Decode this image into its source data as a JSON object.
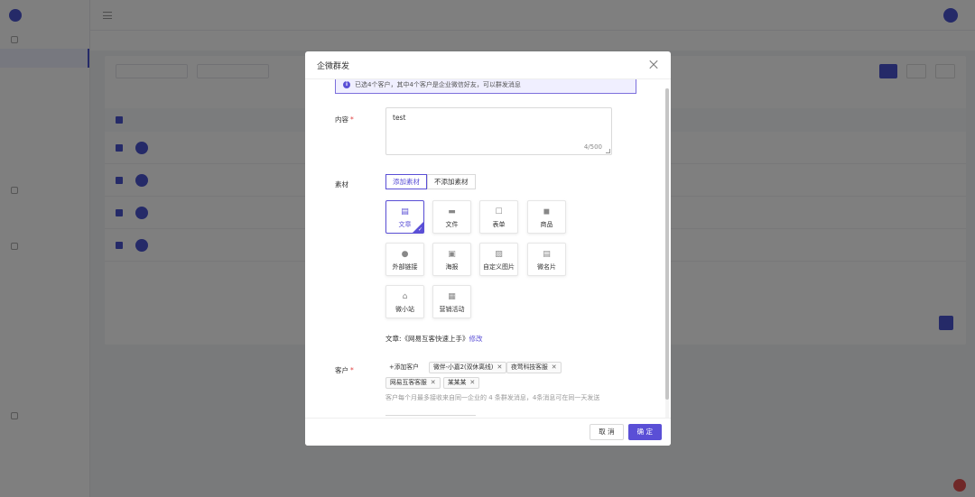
{
  "modal": {
    "title": "企微群发",
    "info_text": "已选4个客户，其中4个客户是企业微信好友，可以群发消息",
    "content_label": "内容",
    "content_value": "test",
    "content_count": "4/500",
    "material_label": "素材",
    "seg_add": "添加素材",
    "seg_none": "不添加素材",
    "materials": [
      {
        "label": "文章",
        "icon": "article-icon",
        "selected": true
      },
      {
        "label": "文件",
        "icon": "folder-icon"
      },
      {
        "label": "表单",
        "icon": "form-icon"
      },
      {
        "label": "商品",
        "icon": "product-icon"
      },
      {
        "label": "外部链接",
        "icon": "link-icon"
      },
      {
        "label": "海报",
        "icon": "poster-icon"
      },
      {
        "label": "自定义图片",
        "icon": "image-icon"
      },
      {
        "label": "微名片",
        "icon": "card-icon"
      },
      {
        "label": "微小站",
        "icon": "home-icon"
      },
      {
        "label": "营销活动",
        "icon": "gift-icon"
      }
    ],
    "article_prefix": "文章:《网易互客快速上手》",
    "article_edit": "修改",
    "customer_label": "客户",
    "add_customer": "+添加客户",
    "customer_tags": [
      "微伴-小嘉2(双休离线)",
      "夜莺科技客服",
      "网易互客客服",
      "某某某"
    ],
    "customer_hint": "客户每个月最多接收来自同一企业的 4 条群发消息，4条消息可在同一天发送",
    "cancel_label": "取 消",
    "ok_label": "确 定"
  }
}
